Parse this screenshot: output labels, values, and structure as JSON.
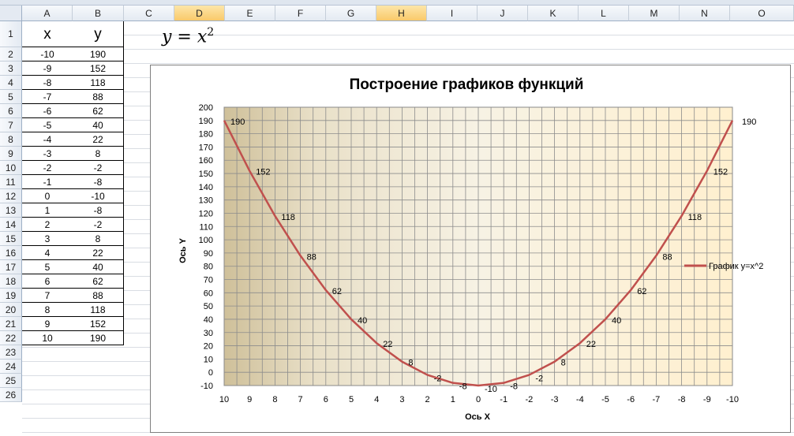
{
  "columns": [
    "A",
    "B",
    "C",
    "D",
    "E",
    "F",
    "G",
    "H",
    "I",
    "J",
    "K",
    "L",
    "M",
    "N",
    "O"
  ],
  "rows": [
    "1",
    "2",
    "3",
    "4",
    "5",
    "6",
    "7",
    "8",
    "9",
    "10",
    "11",
    "12",
    "13",
    "14",
    "15",
    "16",
    "17",
    "18",
    "19",
    "20",
    "21",
    "22",
    "23",
    "24",
    "25",
    "26"
  ],
  "table": {
    "header_x": "x",
    "header_y": "y",
    "x": [
      "-10",
      "-9",
      "-8",
      "-7",
      "-6",
      "-5",
      "-4",
      "-3",
      "-2",
      "-1",
      "0",
      "1",
      "2",
      "3",
      "4",
      "5",
      "6",
      "7",
      "8",
      "9",
      "10"
    ],
    "y": [
      "190",
      "152",
      "118",
      "88",
      "62",
      "40",
      "22",
      "8",
      "-2",
      "-8",
      "-10",
      "-8",
      "-2",
      "8",
      "22",
      "40",
      "62",
      "88",
      "118",
      "152",
      "190"
    ]
  },
  "formula": {
    "lhs": "y = x",
    "exp": "2"
  },
  "chart_data": {
    "type": "line",
    "title": "Построение графиков функций",
    "xlabel": "Ось  X",
    "ylabel": "Ось Y",
    "categories": [
      "10",
      "9",
      "8",
      "7",
      "6",
      "5",
      "4",
      "3",
      "2",
      "1",
      "0",
      "-1",
      "-2",
      "-3",
      "-4",
      "-5",
      "-6",
      "-7",
      "-8",
      "-9",
      "-10"
    ],
    "series": [
      {
        "name": "График y=x^2",
        "values": [
          190,
          152,
          118,
          88,
          62,
          40,
          22,
          8,
          -2,
          -8,
          -10,
          -8,
          -2,
          8,
          22,
          40,
          62,
          88,
          118,
          152,
          190
        ],
        "color": "#c0504d"
      }
    ],
    "ylim": [
      -10,
      200
    ],
    "yticks": [
      -10,
      0,
      10,
      20,
      30,
      40,
      50,
      60,
      70,
      80,
      90,
      100,
      110,
      120,
      130,
      140,
      150,
      160,
      170,
      180,
      190,
      200
    ],
    "grid": true,
    "legend": "right",
    "data_labels": true
  }
}
